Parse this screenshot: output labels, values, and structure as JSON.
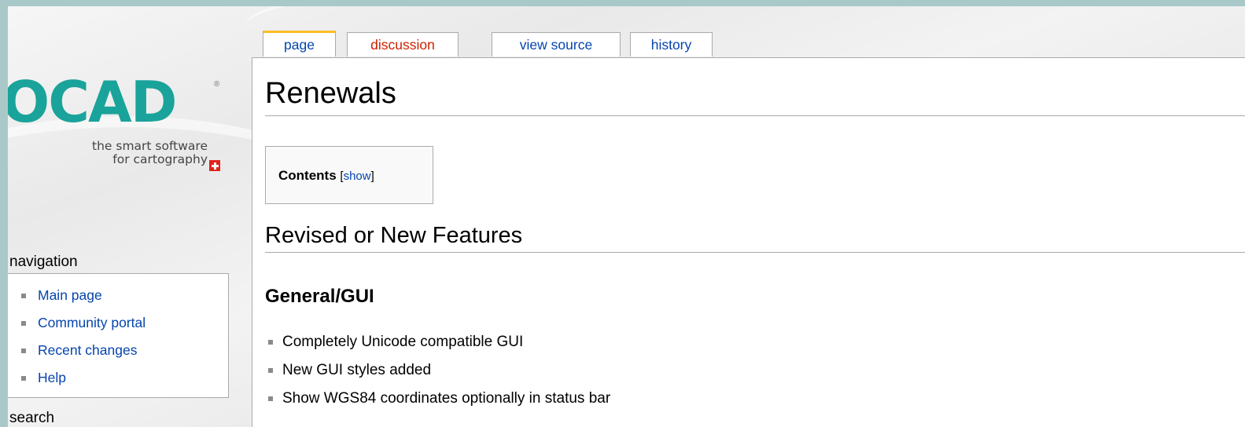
{
  "logo": {
    "wordmark": "OCAD",
    "registered": "®",
    "tagline_line1": "the smart software",
    "tagline_line2": "for cartography"
  },
  "tabs": [
    {
      "label": "page",
      "selected": true
    },
    {
      "label": "discussion",
      "selected": false
    },
    {
      "label": "view source",
      "selected": false
    },
    {
      "label": "history",
      "selected": false
    }
  ],
  "page": {
    "title": "Renewals",
    "toc": {
      "label": "Contents",
      "toggle": "show",
      "open_bracket": "[",
      "close_bracket": "]"
    },
    "section_heading": "Revised or New Features",
    "subsection_heading": "General/GUI",
    "features": [
      "Completely Unicode compatible GUI",
      "New GUI styles added",
      "Show WGS84 coordinates optionally in status bar"
    ]
  },
  "sidebar": {
    "navigation_heading": "navigation",
    "items": [
      {
        "label": "Main page"
      },
      {
        "label": "Community portal"
      },
      {
        "label": "Recent changes"
      },
      {
        "label": "Help"
      }
    ],
    "search_heading": "search"
  },
  "colors": {
    "outer_background": "#a9c9c9",
    "logo_teal": "#1aa39a",
    "link_blue": "#0645ad",
    "new_link_red": "#cc2200",
    "selected_tab_accent": "#fabd23",
    "swiss_red": "#e2231a"
  }
}
